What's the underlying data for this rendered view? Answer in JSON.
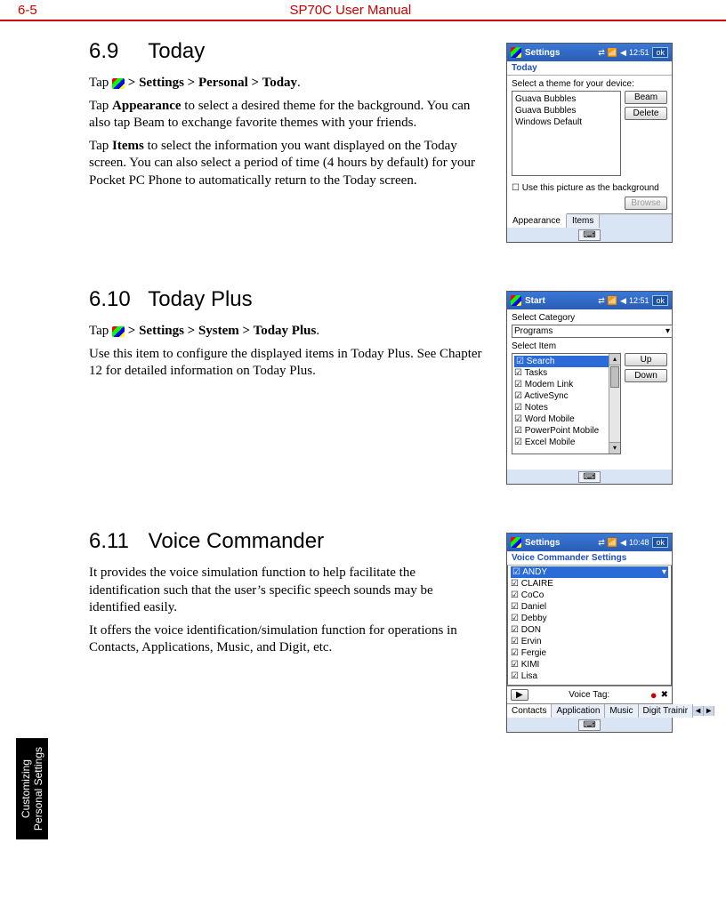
{
  "header": {
    "page": "6-5",
    "title": "SP70C User Manual"
  },
  "sidetab": {
    "line1": "Customizing",
    "line2": "Personal Settings"
  },
  "s69": {
    "num": "6.9",
    "title": "Today",
    "p1_a": "Tap ",
    "p1_b": " > Settings > Personal > Today",
    "p1_c": ".",
    "p2_a": "Tap ",
    "p2_b": "Appearance",
    "p2_c": " to select a desired theme for the background. You can also tap Beam to exchange favorite themes with your friends.",
    "p3_a": "Tap ",
    "p3_b": "Items",
    "p3_c": " to select the information you want displayed on the Today screen. You can also select a period of time (4 hours by default) for your Pocket PC Phone to automatically return to the Today screen.",
    "shot": {
      "bar_title": "Settings",
      "clock": "12:51",
      "ok": "ok",
      "sub": "Today",
      "label": "Select a theme for your device:",
      "themes": [
        "Guava Bubbles",
        "Guava Bubbles",
        "Windows Default"
      ],
      "btn_beam": "Beam",
      "btn_delete": "Delete",
      "cb": "Use this picture as the background",
      "browse": "Browse",
      "tab1": "Appearance",
      "tab2": "Items"
    }
  },
  "s610": {
    "num": "6.10",
    "title": "Today Plus",
    "p1_a": "Tap ",
    "p1_b": " > Settings > System > Today Plus",
    "p1_c": ".",
    "p2": "Use this item to configure the displayed items in Today Plus. See Chapter 12 for detailed information on Today Plus.",
    "shot": {
      "bar_title": "Start",
      "clock": "12:51",
      "ok": "ok",
      "lbl_cat": "Select Category",
      "dd": "Programs",
      "lbl_item": "Select Item",
      "items": [
        "Search",
        "Tasks",
        "Modem Link",
        "ActiveSync",
        "Notes",
        "Word Mobile",
        "PowerPoint Mobile",
        "Excel Mobile"
      ],
      "btn_up": "Up",
      "btn_down": "Down"
    }
  },
  "s611": {
    "num": "6.11",
    "title": "Voice Commander",
    "p1": "It provides the voice simulation function to help facilitate the identification such that the user’s specific speech sounds may be identified easily.",
    "p2": "It offers the voice identification/simulation function for operations in Contacts, Applications, Music, and Digit, etc.",
    "shot": {
      "bar_title": "Settings",
      "clock": "10:48",
      "ok": "ok",
      "sub": "Voice Commander Settings",
      "sel": "ANDY",
      "items": [
        "CLAIRE",
        "CoCo",
        "Daniel",
        "Debby",
        "DON",
        "Ervin",
        "Fergie",
        "KIMI",
        "Lisa"
      ],
      "tag_label": "Voice Tag:",
      "tabs": [
        "Contacts",
        "Application",
        "Music",
        "Digit Trainir"
      ]
    }
  }
}
